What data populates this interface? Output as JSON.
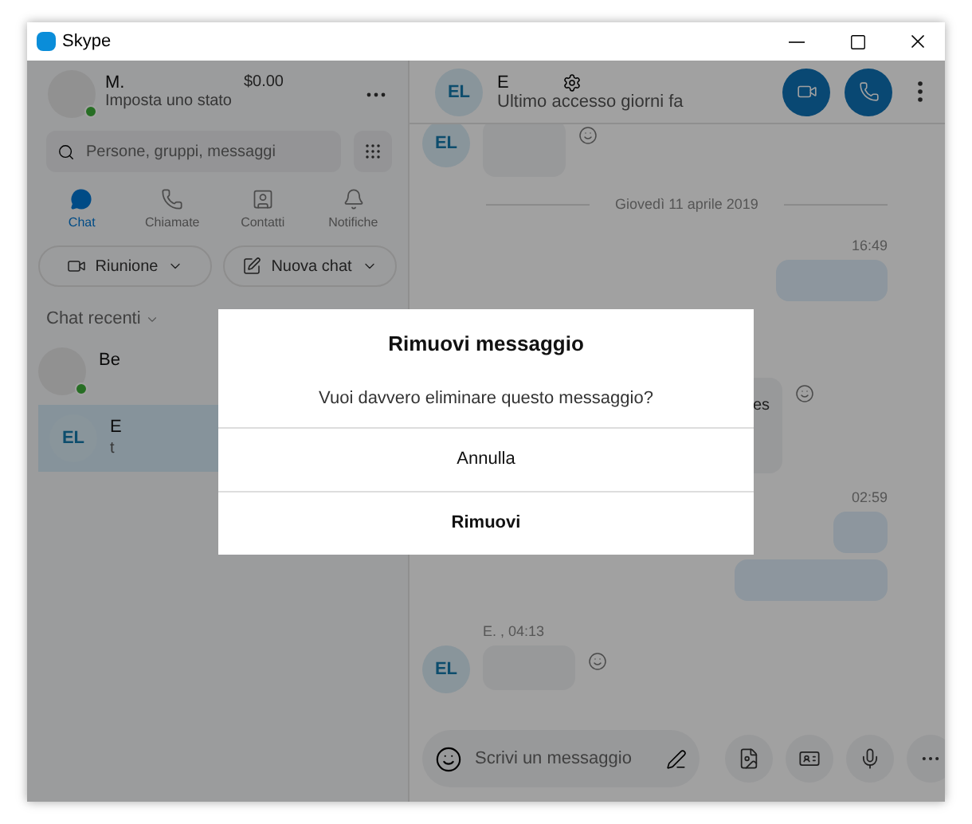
{
  "window": {
    "title": "Skype"
  },
  "profile": {
    "name": "M.",
    "status": "Imposta uno stato",
    "credit": "$0.00",
    "online": true
  },
  "search": {
    "placeholder": "Persone, gruppi, messaggi"
  },
  "nav": [
    {
      "label": "Chat",
      "selected": true
    },
    {
      "label": "Chiamate",
      "selected": false
    },
    {
      "label": "Contatti",
      "selected": false
    },
    {
      "label": "Notifiche",
      "selected": false
    }
  ],
  "actions": [
    {
      "label": "Riunione"
    },
    {
      "label": "Nuova chat"
    }
  ],
  "recent": {
    "heading": "Chat recenti",
    "items": [
      {
        "name": "Be",
        "online": true,
        "selected": false
      },
      {
        "name": "E",
        "initials": "EL",
        "preview": "t",
        "online": false,
        "selected": true
      }
    ]
  },
  "chat": {
    "initials": "EL",
    "name": "E",
    "status": "Ultimo accesso giorni fa"
  },
  "messages": [
    {
      "kind": "incoming",
      "avatar": "EL"
    },
    {
      "kind": "date",
      "text": "Giovedì 11 aprile 2019"
    },
    {
      "kind": "time",
      "text": "16:49"
    },
    {
      "kind": "outgoing"
    },
    {
      "kind": "incoming",
      "text": "es"
    },
    {
      "kind": "time",
      "text": "02:59"
    },
    {
      "kind": "outgoing"
    },
    {
      "kind": "outgoing"
    },
    {
      "kind": "sender",
      "text": "E. , 04:13"
    },
    {
      "kind": "incoming",
      "avatar": "EL"
    }
  ],
  "composer": {
    "placeholder": "Scrivi un messaggio"
  },
  "dialog": {
    "title": "Rimuovi messaggio",
    "message": "Vuoi davvero eliminare questo messaggio?",
    "buttons": [
      {
        "label": "Annulla",
        "primary": false
      },
      {
        "label": "Rimuovi",
        "primary": true
      }
    ]
  }
}
